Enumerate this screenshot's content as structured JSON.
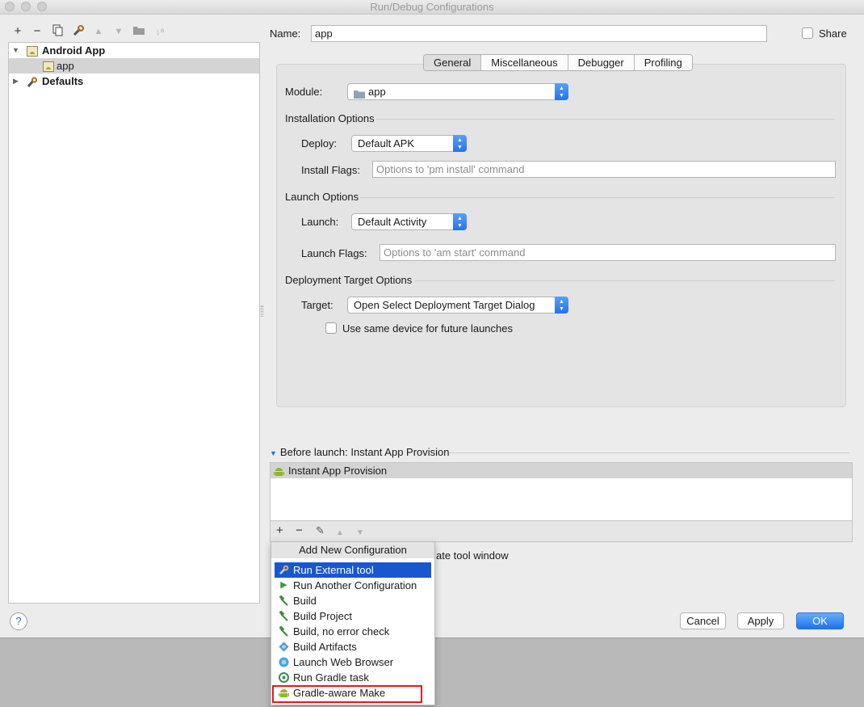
{
  "window": {
    "title": "Run/Debug Configurations"
  },
  "toolbar": {
    "icons": [
      "plus-icon",
      "minus-icon",
      "copy-icon",
      "wrench-icon",
      "up-arrow-icon",
      "down-arrow-icon",
      "folder-icon",
      "sort-icon"
    ]
  },
  "tree": {
    "items": [
      {
        "label": "Android App",
        "expanded": true
      },
      {
        "label": "app",
        "selected": true
      },
      {
        "label": "Defaults",
        "expanded": false
      }
    ]
  },
  "form": {
    "name_label": "Name:",
    "name_value": "app",
    "share_label": "Share",
    "share_checked": false
  },
  "tabs": [
    "General",
    "Miscellaneous",
    "Debugger",
    "Profiling"
  ],
  "active_tab": "General",
  "general": {
    "module_label": "Module:",
    "module_value": "app",
    "installation_title": "Installation Options",
    "deploy_label": "Deploy:",
    "deploy_value": "Default APK",
    "install_flags_label": "Install Flags:",
    "install_flags_placeholder": "Options to 'pm install' command",
    "launch_title": "Launch Options",
    "launch_label": "Launch:",
    "launch_value": "Default Activity",
    "launch_flags_label": "Launch Flags:",
    "launch_flags_placeholder": "Options to 'am start' command",
    "target_title": "Deployment Target Options",
    "target_label": "Target:",
    "target_value": "Open Select Deployment Target Dialog",
    "same_device_label": "Use same device for future launches",
    "same_device_checked": false
  },
  "before_launch": {
    "header": "Before launch: Instant App Provision",
    "items": [
      "Instant App Provision"
    ],
    "partial_text": "ate tool window"
  },
  "menu": {
    "title": "Add New Configuration",
    "items": [
      {
        "label": "Run External tool",
        "icon": "external-tool-icon",
        "selected": true
      },
      {
        "label": "Run Another Configuration",
        "icon": "play-icon"
      },
      {
        "label": "Build",
        "icon": "hammer-icon"
      },
      {
        "label": "Build Project",
        "icon": "hammer-icon"
      },
      {
        "label": "Build, no error check",
        "icon": "hammer-icon"
      },
      {
        "label": "Build Artifacts",
        "icon": "artifacts-icon"
      },
      {
        "label": "Launch Web Browser",
        "icon": "globe-icon"
      },
      {
        "label": "Run Gradle task",
        "icon": "gradle-icon"
      },
      {
        "label": "Gradle-aware Make",
        "icon": "android-icon",
        "highlighted": true
      }
    ]
  },
  "buttons": {
    "cancel": "Cancel",
    "apply": "Apply",
    "ok": "OK",
    "help": "?"
  },
  "colors": {
    "accent": "#1957d1",
    "primary_button": "#1d73ee",
    "highlight": "#e8161f",
    "android_green": "#8cb829"
  }
}
